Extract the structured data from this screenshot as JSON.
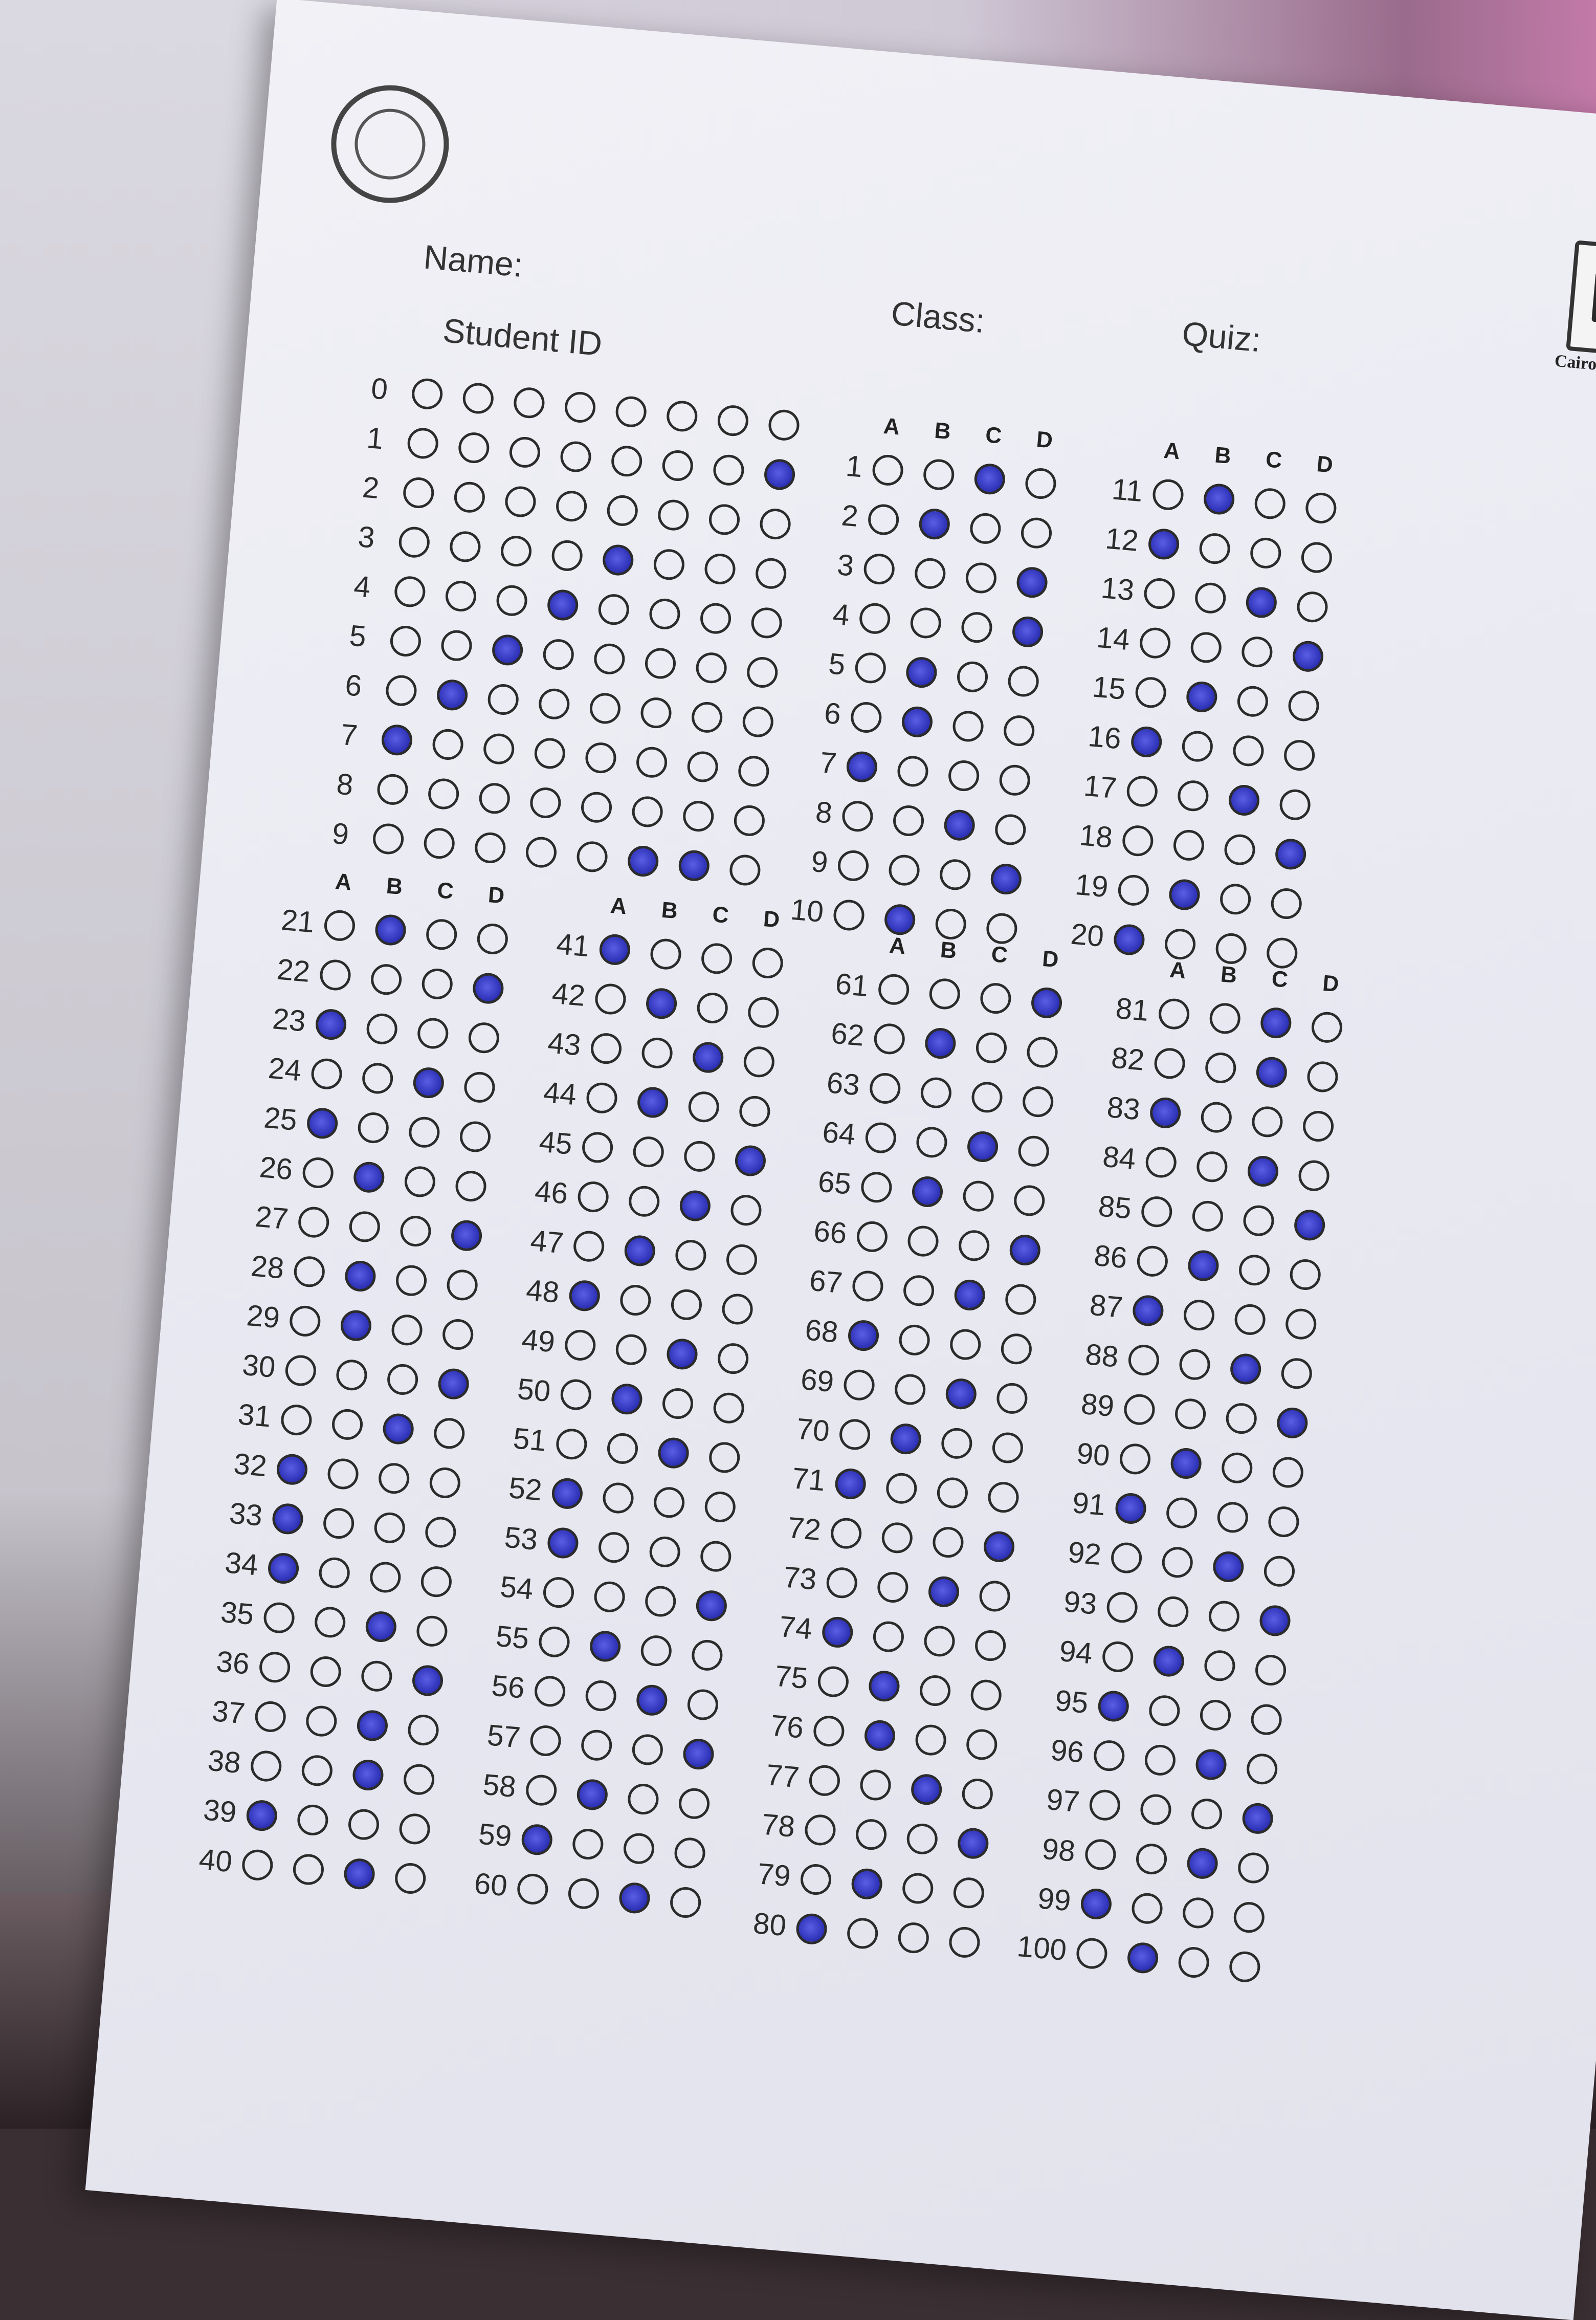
{
  "labels": {
    "name": "Name:",
    "student_id": "Student ID",
    "class": "Class:",
    "quiz": "Quiz:",
    "university": "Cairo Universit"
  },
  "choices": [
    "A",
    "B",
    "C",
    "D"
  ],
  "student_id": {
    "digits": [
      "0",
      "1",
      "2",
      "3",
      "4",
      "5",
      "6",
      "7",
      "8",
      "9"
    ],
    "columns": 8,
    "marked_digit_per_column": [
      "7",
      "6",
      "5",
      "4",
      "3",
      "9",
      "9",
      "1"
    ]
  },
  "answers": [
    {
      "q": "1",
      "a": "C"
    },
    {
      "q": "2",
      "a": "B"
    },
    {
      "q": "3",
      "a": "D"
    },
    {
      "q": "4",
      "a": "D"
    },
    {
      "q": "5",
      "a": "B"
    },
    {
      "q": "6",
      "a": "B"
    },
    {
      "q": "7",
      "a": "A"
    },
    {
      "q": "8",
      "a": "C"
    },
    {
      "q": "9",
      "a": "D"
    },
    {
      "q": "10",
      "a": "B"
    },
    {
      "q": "11",
      "a": "B"
    },
    {
      "q": "12",
      "a": "A"
    },
    {
      "q": "13",
      "a": "C"
    },
    {
      "q": "14",
      "a": "D"
    },
    {
      "q": "15",
      "a": "B"
    },
    {
      "q": "16",
      "a": "A"
    },
    {
      "q": "17",
      "a": "C"
    },
    {
      "q": "18",
      "a": "D"
    },
    {
      "q": "19",
      "a": "B"
    },
    {
      "q": "20",
      "a": "A"
    },
    {
      "q": "21",
      "a": "B"
    },
    {
      "q": "22",
      "a": "D"
    },
    {
      "q": "23",
      "a": "A"
    },
    {
      "q": "24",
      "a": "C"
    },
    {
      "q": "25",
      "a": "A"
    },
    {
      "q": "26",
      "a": "B"
    },
    {
      "q": "27",
      "a": "D"
    },
    {
      "q": "28",
      "a": "B"
    },
    {
      "q": "29",
      "a": "B"
    },
    {
      "q": "30",
      "a": "D"
    },
    {
      "q": "31",
      "a": "C"
    },
    {
      "q": "32",
      "a": "A"
    },
    {
      "q": "33",
      "a": "A"
    },
    {
      "q": "34",
      "a": "A"
    },
    {
      "q": "35",
      "a": "C"
    },
    {
      "q": "36",
      "a": "D"
    },
    {
      "q": "37",
      "a": "C"
    },
    {
      "q": "38",
      "a": "C"
    },
    {
      "q": "39",
      "a": "A"
    },
    {
      "q": "40",
      "a": "C"
    },
    {
      "q": "41",
      "a": "A"
    },
    {
      "q": "42",
      "a": "B"
    },
    {
      "q": "43",
      "a": "C"
    },
    {
      "q": "44",
      "a": "B"
    },
    {
      "q": "45",
      "a": "D"
    },
    {
      "q": "46",
      "a": "C"
    },
    {
      "q": "47",
      "a": "B"
    },
    {
      "q": "48",
      "a": "A"
    },
    {
      "q": "49",
      "a": "C"
    },
    {
      "q": "50",
      "a": "B"
    },
    {
      "q": "51",
      "a": "C"
    },
    {
      "q": "52",
      "a": "A"
    },
    {
      "q": "53",
      "a": "A"
    },
    {
      "q": "54",
      "a": "D"
    },
    {
      "q": "55",
      "a": "B"
    },
    {
      "q": "56",
      "a": "C"
    },
    {
      "q": "57",
      "a": "D"
    },
    {
      "q": "58",
      "a": "B"
    },
    {
      "q": "59",
      "a": "A"
    },
    {
      "q": "60",
      "a": "C"
    },
    {
      "q": "61",
      "a": "D"
    },
    {
      "q": "62",
      "a": "B"
    },
    {
      "q": "63",
      "a": ""
    },
    {
      "q": "64",
      "a": "C"
    },
    {
      "q": "65",
      "a": "B"
    },
    {
      "q": "66",
      "a": "D"
    },
    {
      "q": "67",
      "a": "C"
    },
    {
      "q": "68",
      "a": "A"
    },
    {
      "q": "69",
      "a": "C"
    },
    {
      "q": "70",
      "a": "B"
    },
    {
      "q": "71",
      "a": "A"
    },
    {
      "q": "72",
      "a": "D"
    },
    {
      "q": "73",
      "a": "C"
    },
    {
      "q": "74",
      "a": "A"
    },
    {
      "q": "75",
      "a": "B"
    },
    {
      "q": "76",
      "a": "B"
    },
    {
      "q": "77",
      "a": "C"
    },
    {
      "q": "78",
      "a": "D"
    },
    {
      "q": "79",
      "a": "B"
    },
    {
      "q": "80",
      "a": "A"
    },
    {
      "q": "81",
      "a": "C"
    },
    {
      "q": "82",
      "a": "C"
    },
    {
      "q": "83",
      "a": "A"
    },
    {
      "q": "84",
      "a": "C"
    },
    {
      "q": "85",
      "a": "D"
    },
    {
      "q": "86",
      "a": "B"
    },
    {
      "q": "87",
      "a": "A"
    },
    {
      "q": "88",
      "a": "C"
    },
    {
      "q": "89",
      "a": "D"
    },
    {
      "q": "90",
      "a": "B"
    },
    {
      "q": "91",
      "a": "A"
    },
    {
      "q": "92",
      "a": "C"
    },
    {
      "q": "93",
      "a": "D"
    },
    {
      "q": "94",
      "a": "B"
    },
    {
      "q": "95",
      "a": "A"
    },
    {
      "q": "96",
      "a": "C"
    },
    {
      "q": "97",
      "a": "D"
    },
    {
      "q": "98",
      "a": "C"
    },
    {
      "q": "99",
      "a": "A"
    },
    {
      "q": "100",
      "a": "B"
    }
  ],
  "colors": {
    "ink": "#2f33b8",
    "paper": "#ececf3",
    "background_flower": "#c27aa8"
  }
}
